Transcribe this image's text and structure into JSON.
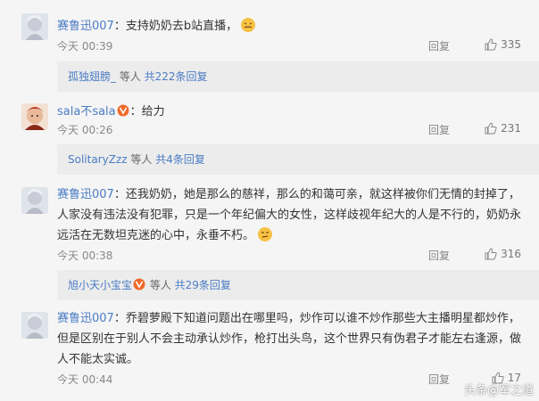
{
  "comments": [
    {
      "user": "赛鲁迅007",
      "text": "：支持奶奶去b站直播，",
      "time": "今天 00:39",
      "reply": "回复",
      "likes": "335",
      "subreplies": {
        "user": "孤独翅膀_",
        "suffix": " 等人 ",
        "count": "共222条回复"
      }
    },
    {
      "user": "sala不sala",
      "text": "：给力",
      "time": "今天 00:26",
      "reply": "回复",
      "likes": "231",
      "subreplies": {
        "user": "SolitaryZzz",
        "suffix": " 等人 ",
        "count": "共4条回复"
      }
    },
    {
      "user": "赛鲁迅007",
      "text": "：还我奶奶，她是那么的慈祥，那么的和蔼可亲，就这样被你们无情的封掉了，人家没有违法没有犯罪，只是一个年纪偏大的女性，这样歧视年纪大的人是不行的，奶奶永远活在无数坦克迷的心中，永垂不朽。",
      "time": "今天 00:38",
      "reply": "回复",
      "likes": "316",
      "subreplies": {
        "user": "旭小天小宝宝",
        "suffix": " 等人 ",
        "count": "共29条回复"
      }
    },
    {
      "user": "赛鲁迅007",
      "text": "：乔碧萝殿下知道问题出在哪里吗，炒作可以谁不炒作那些大主播明星都炒作，但是区别在于别人不会主动承认炒作，枪打出头鸟，这个世界只有伪君子才能左右逢源，做人不能太实诚。",
      "time": "今天 00:44",
      "reply": "回复",
      "likes": "17"
    }
  ],
  "watermark": "头条@军之道",
  "colors": {
    "link": "#4a7cc4",
    "background": "#f5f5f5",
    "subbar": "#ececec"
  }
}
